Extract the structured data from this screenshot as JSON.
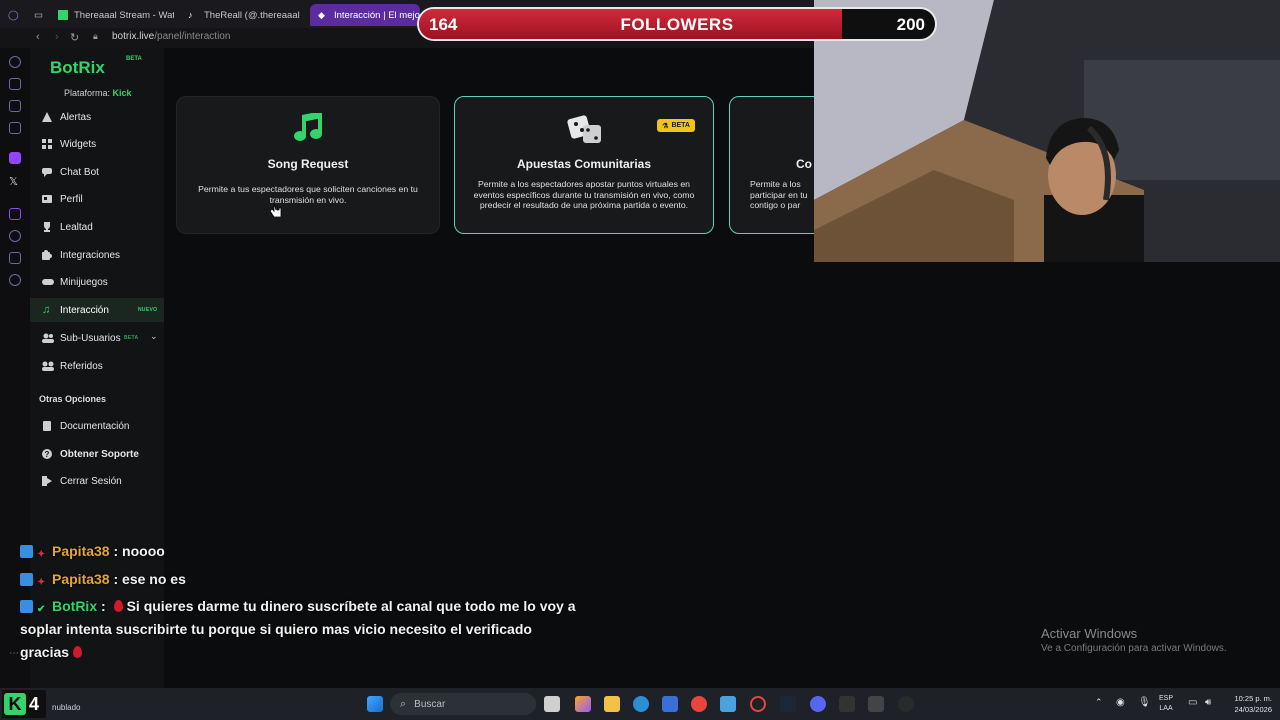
{
  "browser": {
    "tabs": [
      {
        "label": "Thereaaal Stream - Watch"
      },
      {
        "label": "TheReall (@.thereaaal) | T"
      },
      {
        "label": "Interacción | El mejor so"
      }
    ],
    "url_host": "botrix.live",
    "url_path": "/panel/interaction"
  },
  "sidebar": {
    "brand": "BotRix",
    "brand_tag": "BETA",
    "platform_label": "Plataforma:",
    "platform_value": "Kick",
    "items": [
      {
        "label": "Alertas",
        "icon": "warning-icon"
      },
      {
        "label": "Widgets",
        "icon": "grid-icon"
      },
      {
        "label": "Chat Bot",
        "icon": "chat-icon"
      },
      {
        "label": "Perfil",
        "icon": "profile-card-icon"
      },
      {
        "label": "Lealtad",
        "icon": "trophy-icon"
      },
      {
        "label": "Integraciones",
        "icon": "puzzle-icon"
      },
      {
        "label": "Minijuegos",
        "icon": "gamepad-icon"
      },
      {
        "label": "Interacción",
        "icon": "music-note-icon",
        "tag": "NUEVO"
      },
      {
        "label": "Sub-Usuarios",
        "icon": "users-icon",
        "tag": "BETA"
      },
      {
        "label": "Referidos",
        "icon": "group-icon"
      }
    ],
    "other_title": "Otras Opciones",
    "other_items": [
      {
        "label": "Documentación",
        "icon": "document-icon"
      },
      {
        "label": "Obtener Soporte",
        "icon": "help-icon"
      },
      {
        "label": "Cerrar Sesión",
        "icon": "logout-icon"
      }
    ]
  },
  "cards": [
    {
      "title": "Song Request",
      "desc": "Permite a tus espectadores que soliciten canciones en tu transmisión en vivo.",
      "icon": "music-notes-icon"
    },
    {
      "title": "Apuestas Comunitarias",
      "desc": "Permite a los espectadores apostar puntos virtuales en eventos específicos durante tu transmisión en vivo, como predecir el resultado de una próxima partida o evento.",
      "icon": "dice-icon",
      "badge": "BETA"
    },
    {
      "title": "Co",
      "desc": "Permite a los participar en tu contigo o par",
      "icon": "unknown"
    }
  ],
  "goal": {
    "current": "164",
    "label": "FOLLOWERS",
    "target": "200",
    "progress": 0.82,
    "fill_color": "#c8202f"
  },
  "chat": [
    {
      "user": "Papita38",
      "sep": " :",
      "text": " noooo"
    },
    {
      "user": "Papita38",
      "sep": " :",
      "text": " ese no es"
    },
    {
      "user": "BotRix",
      "sep": " :",
      "text_1": "Si quieres darme tu dinero suscríbete al canal que todo me lo voy a",
      "text_2": "soplar intenta suscribirte tu porque si quiero mas vicio necesito el verificado",
      "text_3": "gracias"
    }
  ],
  "activate": {
    "title": "Activar Windows",
    "sub": "Ve a Configuración para activar Windows."
  },
  "taskbar": {
    "kick_num": "4",
    "weather": "nublado",
    "search_placeholder": "Buscar",
    "lang_1": "ESP",
    "lang_2": "LAA",
    "time": "10:25 p. m.",
    "date": "24/03/2026"
  },
  "colors": {
    "accent_green": "#35d46b",
    "highlight_border": "#5fd1b8",
    "beta_yellow": "#f2c41b"
  }
}
